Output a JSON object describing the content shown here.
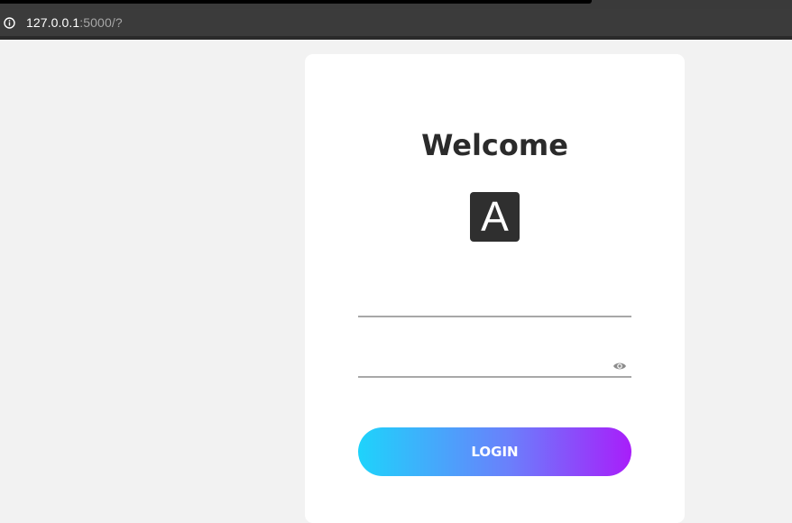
{
  "browser": {
    "url_host": "127.0.0.1",
    "url_path": ":5000/?"
  },
  "login": {
    "title": "Welcome",
    "logo_letter": "A",
    "username": {
      "value": "",
      "placeholder": ""
    },
    "password": {
      "value": "",
      "placeholder": ""
    },
    "login_label": "LOGIN"
  },
  "colors": {
    "page_background": "#f2f2f2",
    "card_background": "#ffffff",
    "logo_background": "#2f2f2f",
    "button_gradient_start": "#1ed3fb",
    "button_gradient_mid": "#6a80fb",
    "button_gradient_end": "#a81efa"
  },
  "icons": {
    "address_bar": "info-icon",
    "password_toggle": "eye-icon"
  }
}
